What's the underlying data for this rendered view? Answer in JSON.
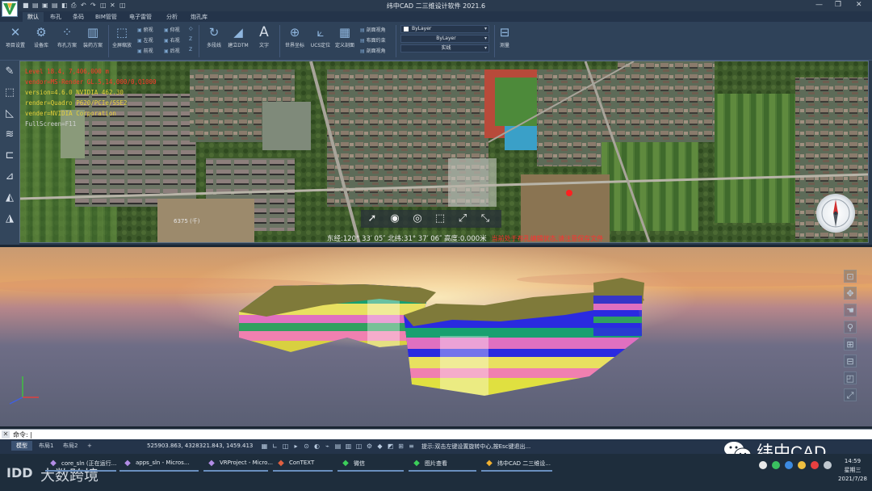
{
  "window": {
    "title": "纬中CAD 二三维设计软件 2021.6",
    "quick_access": [
      "■",
      "▤",
      "▣",
      "▤",
      "◧",
      "⎙",
      "↶",
      "↷",
      "◫",
      "✕",
      "◫"
    ],
    "controls": [
      "—",
      "❐",
      "✕"
    ]
  },
  "ribbon": {
    "tabs": [
      "默认",
      "布孔",
      "条码",
      "BIM管管",
      "电子雷管",
      "分析",
      "炮孔库"
    ],
    "big_buttons": [
      {
        "label": "项目设置",
        "icon": "tools-icon",
        "glyph": "✕"
      },
      {
        "label": "设备库",
        "icon": "equipment-icon",
        "glyph": "⚙"
      },
      {
        "label": "布孔方案",
        "icon": "hole-layout-icon",
        "glyph": "⁘"
      },
      {
        "label": "装药方案",
        "icon": "charge-icon",
        "glyph": "▥"
      },
      {
        "label": "全屏缩放",
        "icon": "fullscreen-zoom-icon",
        "glyph": "⬚"
      },
      {
        "label": "多段线",
        "icon": "polyline-icon",
        "glyph": "↻"
      },
      {
        "label": "建立DTM",
        "icon": "dtm-icon",
        "glyph": "◢"
      },
      {
        "label": "文字",
        "icon": "text-icon",
        "glyph": "A"
      },
      {
        "label": "世界坐标",
        "icon": "world-coord-icon",
        "glyph": "⊕"
      },
      {
        "label": "UCS定位",
        "icon": "ucs-icon",
        "glyph": "⟀"
      },
      {
        "label": "定义剖面",
        "icon": "section-icon",
        "glyph": "▦"
      },
      {
        "label": "测量",
        "icon": "measure-icon",
        "glyph": "⊟"
      }
    ],
    "small_buttons_col1": [
      "俯视",
      "左视",
      "前视"
    ],
    "small_buttons_col2": [
      "仰视",
      "右视",
      "后视"
    ],
    "view_buttons": [
      "剖面视角",
      "布面约束",
      "剖面视角"
    ],
    "layer_value": "ByLayer",
    "linetype_value": "ByLayer",
    "lineweight_value": "实线",
    "zoom_glyphs": [
      "◇",
      "Z",
      "Z"
    ]
  },
  "map": {
    "info_lines": [
      {
        "text": "Level 18.4, 7,406,000 m",
        "color": "#ff3a2a"
      },
      {
        "text": "vendor=MS-Render GL.5,14,000/0,Q1000",
        "color": "#ff3a2a"
      },
      {
        "text": "version=4.6.0 NVIDIA 462.30",
        "color": "#e8d23a"
      },
      {
        "text": "render=Quadro P620/PCIe/SSE2",
        "color": "#e8d23a"
      },
      {
        "text": "vender=NVIDIA Corporation",
        "color": "#e8d23a"
      },
      {
        "text": "FullScreen=F11",
        "color": "#d0d0d0"
      }
    ],
    "scale_label": "6375 (千)",
    "coord_readout": "东经:120° 33′ 05″  北纬:31° 37′ 06″  高度:0.000米",
    "status_red": "当前处于布孔编辑状态,请注意保存文件",
    "left_tools": [
      "✎",
      "⬚",
      "◺",
      "≋",
      "⊏",
      "⊿",
      "◭",
      "◮"
    ],
    "toolbar_glyphs": [
      "➚",
      "◉",
      "◎",
      "⬚",
      "⤢",
      "⤡"
    ]
  },
  "scene": {
    "nav_tools": [
      "⊡",
      "✥",
      "☚",
      "⚲",
      "⊞",
      "⊟",
      "◰",
      "⤢"
    ]
  },
  "command": {
    "prompt": "命令: |"
  },
  "status": {
    "layout_tabs": [
      "模型",
      "布局1",
      "布局2"
    ],
    "add_tab": "+",
    "coords": "525903.863, 4328321.843, 1459.413",
    "hint": "提示:双击左键设置旋转中心,按Esc键退出...",
    "icons": [
      "▦",
      "∟",
      "◫",
      "▸",
      "⊙",
      "◐",
      "⌁",
      "▤",
      "▥",
      "◫",
      "⚙",
      "◆",
      "◩",
      "⊞",
      "≡"
    ]
  },
  "watermark": {
    "text": "纬中CAD"
  },
  "taskbar": {
    "items": [
      {
        "label": "core_sln (正在运行...",
        "icon": "visual-studio-icon",
        "color": "#b28de6"
      },
      {
        "label": "apps_sln - Micros...",
        "icon": "visual-studio-icon",
        "color": "#b28de6"
      },
      {
        "label": "VRProject - Micro...",
        "icon": "visual-studio-icon",
        "color": "#b28de6"
      },
      {
        "label": "ConTEXT",
        "icon": "context-icon",
        "color": "#e06040"
      },
      {
        "label": "微信",
        "icon": "wechat-icon",
        "color": "#3ccf5a"
      },
      {
        "label": "图片查看",
        "icon": "image-viewer-icon",
        "color": "#3ccf5a"
      },
      {
        "label": "纬中CAD 二三维设...",
        "icon": "weizhong-cad-icon",
        "color": "#f0b030"
      }
    ],
    "clock_time": "14:59",
    "clock_day": "星期三",
    "clock_date": "2021/7/28",
    "bottom_logo": "大数跨境"
  },
  "colors": {
    "ribbon_bg": "#2f4259",
    "titlebar_bg": "#2a3a4e",
    "accent": "#6a8fbf"
  }
}
